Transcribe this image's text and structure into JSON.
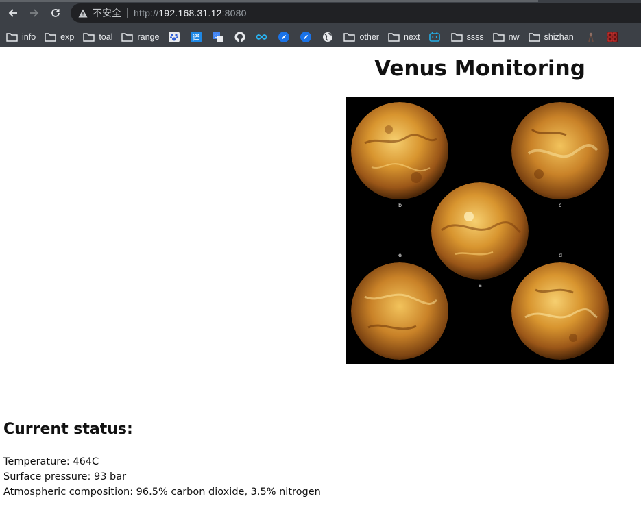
{
  "browser": {
    "address": {
      "security_text": "不安全",
      "url_scheme": "http://",
      "url_host": "192.168.31.12",
      "url_port": ":8080"
    },
    "bookmarks": [
      {
        "type": "folder",
        "label": "info"
      },
      {
        "type": "folder",
        "label": "exp"
      },
      {
        "type": "folder",
        "label": "toal"
      },
      {
        "type": "folder",
        "label": "range"
      },
      {
        "type": "icon",
        "icon": "baidu-paw-icon"
      },
      {
        "type": "icon",
        "icon": "translate-icon"
      },
      {
        "type": "icon",
        "icon": "google-translate-icon"
      },
      {
        "type": "icon",
        "icon": "github-icon"
      },
      {
        "type": "icon",
        "icon": "infinity-icon"
      },
      {
        "type": "icon",
        "icon": "feather-icon"
      },
      {
        "type": "icon",
        "icon": "feather-icon"
      },
      {
        "type": "icon",
        "icon": "globe-icon"
      },
      {
        "type": "folder",
        "label": "other"
      },
      {
        "type": "folder",
        "label": "next"
      },
      {
        "type": "icon",
        "icon": "bilibili-icon"
      },
      {
        "type": "folder",
        "label": "ssss"
      },
      {
        "type": "folder",
        "label": "nw"
      },
      {
        "type": "folder",
        "label": "shizhan"
      }
    ]
  },
  "page": {
    "title": "Venus Monitoring",
    "figure_labels": {
      "a": "a",
      "b": "b",
      "c": "c",
      "d": "d",
      "e": "e"
    },
    "status_heading": "Current status:",
    "status": {
      "temperature": "Temperature: 464C",
      "pressure": "Surface pressure: 93 bar",
      "composition": "Atmospheric composition: 96.5% carbon dioxide, 3.5% nitrogen"
    }
  },
  "colors": {
    "chrome_bg": "#3c4046",
    "omnibox_bg": "#202124",
    "venus_light": "#f2c25a",
    "venus_mid": "#c9842a",
    "venus_dark": "#6b3a10"
  }
}
